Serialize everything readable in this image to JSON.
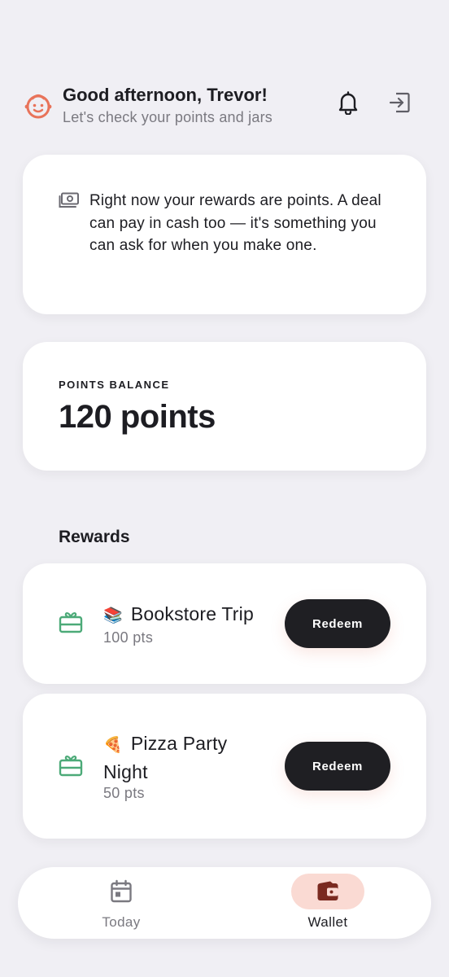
{
  "header": {
    "greeting": "Good afternoon, Trevor!",
    "subtitle": "Let's check your points and jars",
    "avatar_icon": "baby-face-icon",
    "bell_icon": "bell-icon",
    "logout_icon": "logout-icon"
  },
  "info": {
    "icon": "cash-icon",
    "text": "Right now your rewards are points. A deal can pay in cash too — it's something you can ask for when you make one."
  },
  "balance": {
    "label": "POINTS BALANCE",
    "value": "120 points"
  },
  "rewards": {
    "title": "Rewards",
    "items": [
      {
        "emoji": "📚",
        "name": "Bookstore Trip",
        "points": "100 pts",
        "button": "Redeem",
        "icon": "gift-icon"
      },
      {
        "emoji": "🍕",
        "name": "Pizza Party Night",
        "points": "50 pts",
        "button": "Redeem",
        "icon": "gift-icon"
      }
    ]
  },
  "nav": {
    "items": [
      {
        "label": "Today",
        "icon": "calendar-icon",
        "active": false
      },
      {
        "label": "Wallet",
        "icon": "wallet-icon",
        "active": true
      }
    ]
  },
  "colors": {
    "background": "#f0eff4",
    "accent": "#e8735a",
    "gift_green": "#4caa78",
    "dark_button": "#1f1f23",
    "wallet_pill": "#fadad3",
    "wallet_icon": "#7a2a20"
  }
}
